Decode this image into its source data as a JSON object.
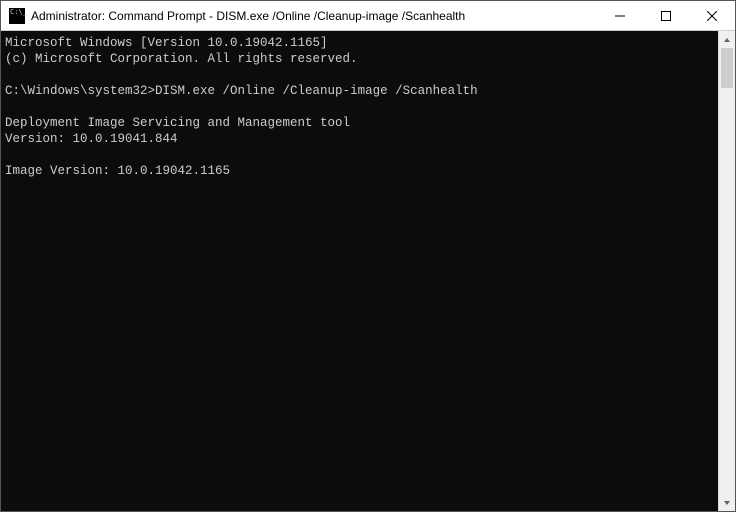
{
  "window": {
    "title": "Administrator: Command Prompt - DISM.exe  /Online /Cleanup-image /Scanhealth"
  },
  "terminal": {
    "line1": "Microsoft Windows [Version 10.0.19042.1165]",
    "line2": "(c) Microsoft Corporation. All rights reserved.",
    "blank": "",
    "prompt": "C:\\Windows\\system32>",
    "command": "DISM.exe /Online /Cleanup-image /Scanhealth",
    "out1": "Deployment Image Servicing and Management tool",
    "out2": "Version: 10.0.19041.844",
    "out3": "Image Version: 10.0.19042.1165"
  }
}
